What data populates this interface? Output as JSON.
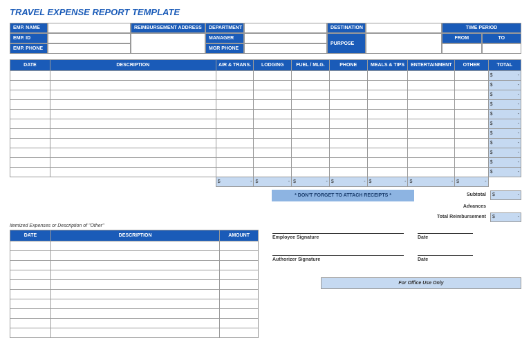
{
  "title": "TRAVEL EXPENSE REPORT TEMPLATE",
  "info": {
    "emp_name_label": "EMP. NAME",
    "emp_id_label": "EMP. ID",
    "emp_phone_label": "EMP. PHONE",
    "reimb_addr_label": "REIMBURSEMENT ADDRESS",
    "dept_label": "DEPARTMENT",
    "manager_label": "MANAGER",
    "mgr_phone_label": "MGR PHONE",
    "destination_label": "DESTINATION",
    "purpose_label": "PURPOSE",
    "time_period_label": "TIME PERIOD",
    "from_label": "FROM",
    "to_label": "TO"
  },
  "columns": {
    "date": "DATE",
    "description": "DESCRIPTION",
    "air_trans": "AIR & TRANS.",
    "lodging": "LODGING",
    "fuel_mlg": "FUEL / MLG.",
    "phone": "PHONE",
    "meals_tips": "MEALS & TIPS",
    "entertainment": "ENTERTAINMENT",
    "other": "OTHER",
    "total": "TOTAL"
  },
  "currency": "$",
  "dash": "-",
  "reminder": "* DON'T FORGET TO ATTACH RECEIPTS *",
  "summary": {
    "subtotal_label": "Subtotal",
    "advances_label": "Advances",
    "total_reimb_label": "Total Reimbursement"
  },
  "itemized": {
    "title": "Itemized Expenses or Description of \"Other\"",
    "date_label": "DATE",
    "description_label": "DESCRIPTION",
    "amount_label": "AMOUNT"
  },
  "signatures": {
    "employee": "Employee Signature",
    "authorizer": "Authorizer Signature",
    "date": "Date"
  },
  "office_use": "For Office Use Only"
}
